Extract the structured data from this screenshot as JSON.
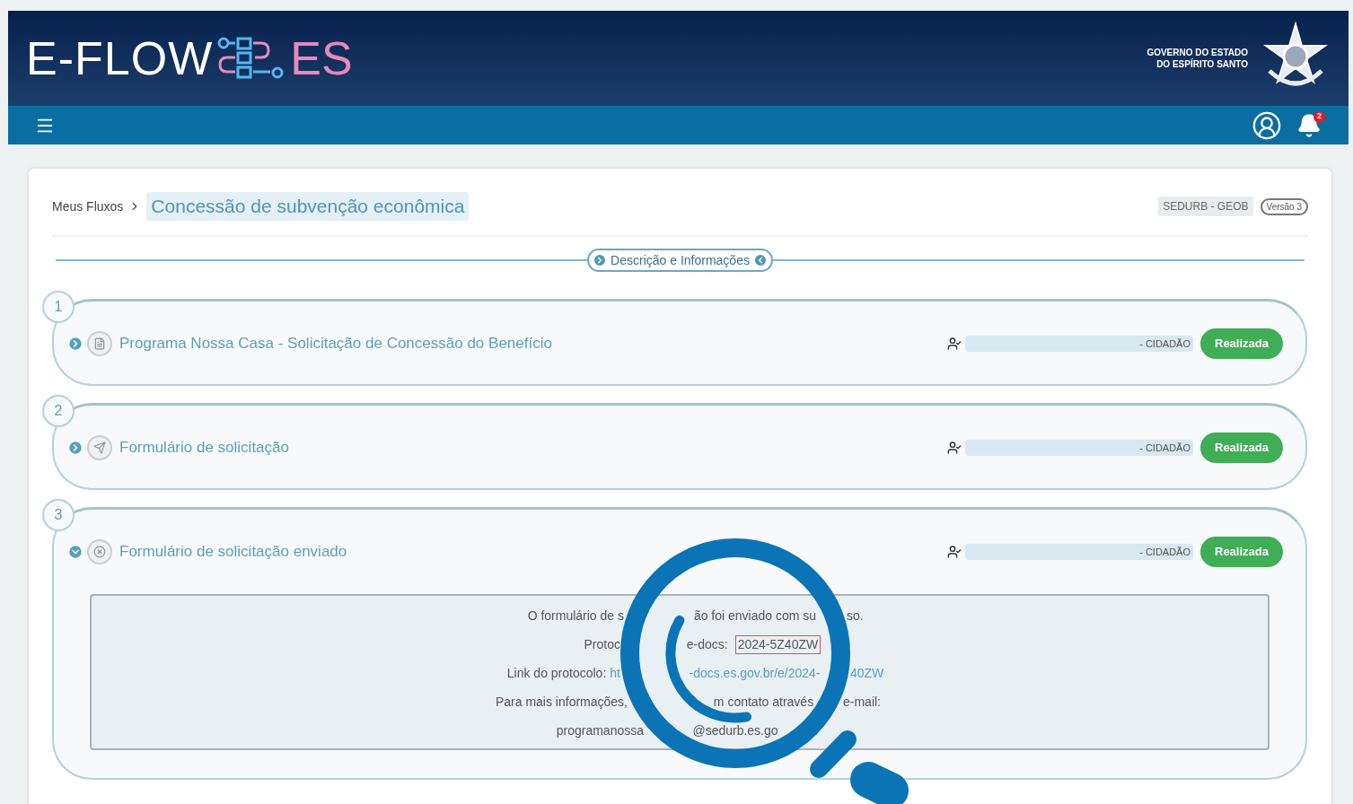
{
  "header": {
    "logo_text": "E-FLOW",
    "logo_suffix": "ES",
    "government": [
      "GOVERNO DO ESTADO",
      "DO ESPÍRITO SANTO"
    ]
  },
  "navbar": {
    "notification_count": "2"
  },
  "breadcrumb": {
    "parent": "Meus Fluxos",
    "current": "Concessão de subvenção econômica"
  },
  "tags": {
    "department": "SEDURB - GEOB",
    "version": "Versão 3"
  },
  "description_toggle": {
    "label": "Descrição e Informações"
  },
  "steps": [
    {
      "number": "1",
      "title": "Programa Nossa Casa - Solicitação de Concessão do Benefício",
      "kind": "document",
      "expanded": false,
      "responsible": "- CIDADÃO",
      "status": "Realizada"
    },
    {
      "number": "2",
      "title": "Formulário de solicitação",
      "kind": "send",
      "expanded": false,
      "responsible": "- CIDADÃO",
      "status": "Realizada"
    },
    {
      "number": "3",
      "title": "Formulário de solicitação enviado",
      "kind": "cancel",
      "expanded": true,
      "responsible": "- CIDADÃO",
      "status": "Realizada",
      "message_lines": [
        {
          "left": [
            {
              "kind": "text",
              "text": "O formulário de s"
            }
          ],
          "middle": [
            {
              "kind": "text",
              "text": "ão foi enviado com su"
            }
          ],
          "right": [
            {
              "kind": "text",
              "text": "so."
            }
          ]
        },
        {
          "left": [
            {
              "kind": "text",
              "text": "Protoc"
            }
          ],
          "middle": [
            {
              "kind": "text",
              "text": "e-docs:"
            },
            {
              "kind": "boxed",
              "text": "2024-5Z40ZW"
            }
          ]
        },
        {
          "left": [
            {
              "kind": "text",
              "text": "Link do protocolo:"
            },
            {
              "kind": "link",
              "text": "ht"
            }
          ],
          "middle": [
            {
              "kind": "link",
              "text": "-docs.es.gov.br/e/2024-"
            }
          ],
          "right": [
            {
              "kind": "link",
              "text": "40ZW"
            }
          ]
        },
        {
          "left": [
            {
              "kind": "text",
              "text": "Para mais informações,"
            }
          ],
          "middle": [
            {
              "kind": "text",
              "text": "m contato através"
            }
          ],
          "right": [
            {
              "kind": "text",
              "text": "e-mail:"
            }
          ]
        },
        {
          "left": [
            {
              "kind": "text",
              "text": "programanossa"
            }
          ],
          "middle": [
            {
              "kind": "text",
              "text": "@sedurb.es.go"
            }
          ]
        }
      ]
    }
  ]
}
